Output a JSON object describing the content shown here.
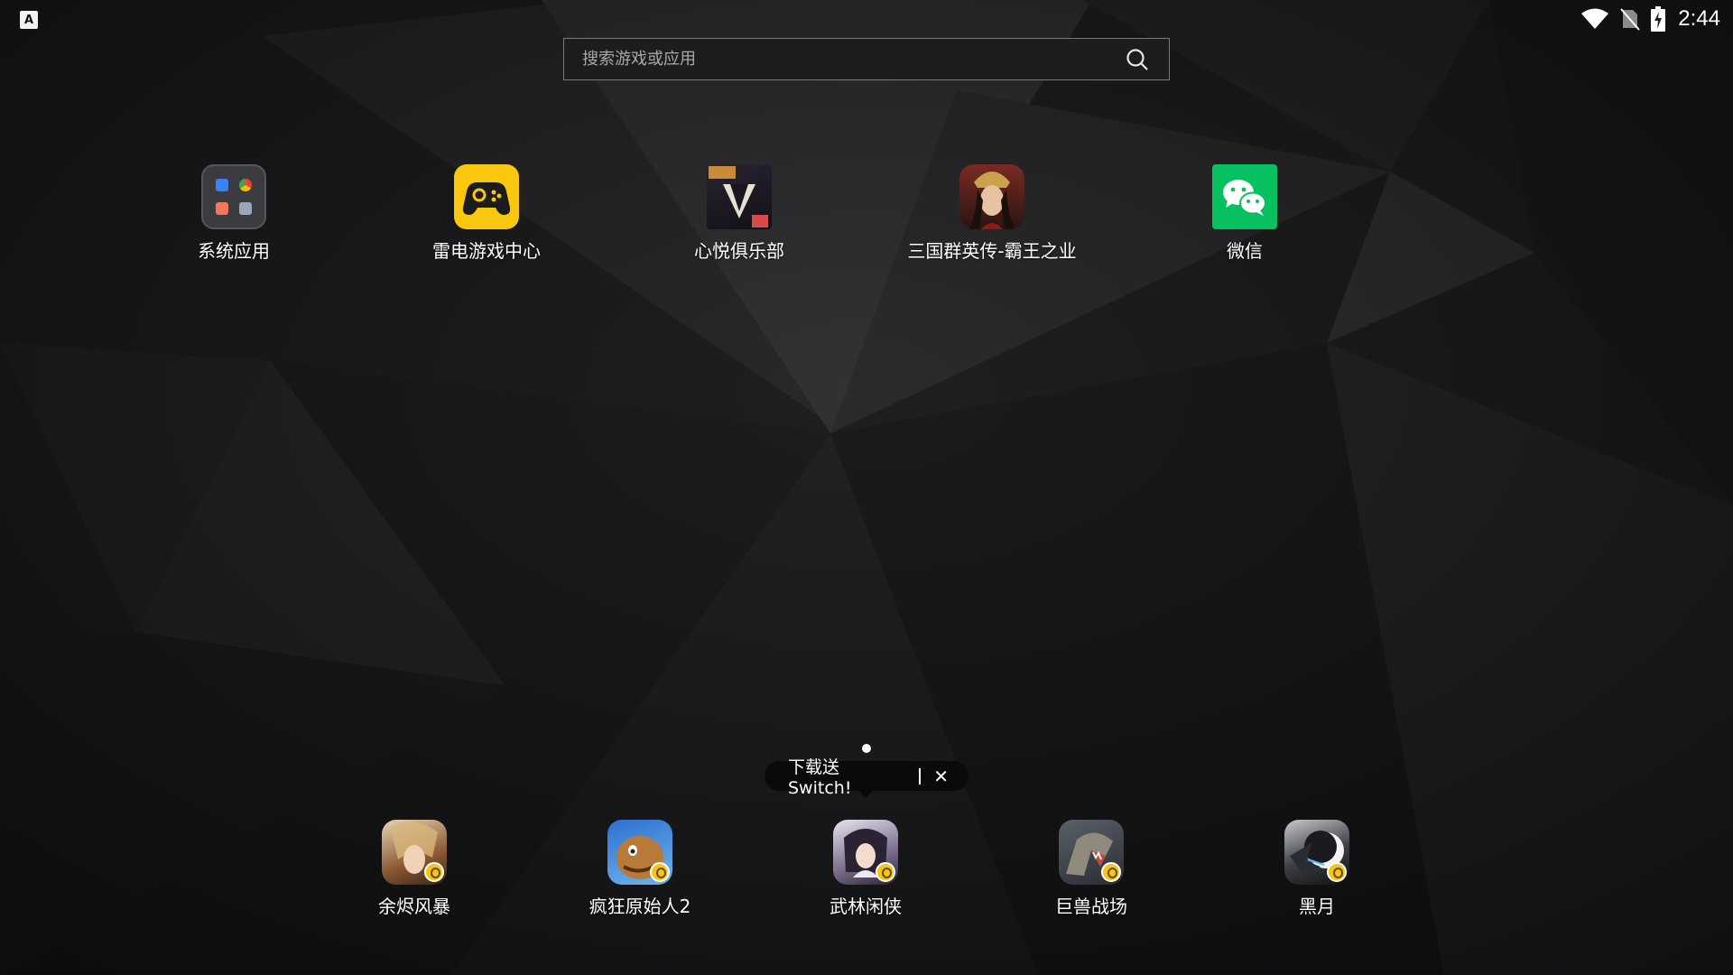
{
  "status_bar": {
    "time": "2:44",
    "notification_icon": "A",
    "icons": [
      "wifi-icon",
      "no-sim-icon",
      "battery-charging-icon"
    ]
  },
  "search": {
    "placeholder": "搜索游戏或应用"
  },
  "desktop_apps": [
    {
      "label": "系统应用",
      "icon": "folder-icon"
    },
    {
      "label": "雷电游戏中心",
      "icon": "gamepad-icon"
    },
    {
      "label": "心悦俱乐部",
      "icon": "xinyue-club-icon"
    },
    {
      "label": "三国群英传-霸王之业",
      "icon": "sanguo-game-icon"
    },
    {
      "label": "微信",
      "icon": "wechat-icon"
    }
  ],
  "promo_tooltip": {
    "text": "下载送Switch!"
  },
  "dock_apps": [
    {
      "label": "余烬风暴",
      "icon": "game-icon"
    },
    {
      "label": "疯狂原始人2",
      "icon": "game-icon"
    },
    {
      "label": "武林闲侠",
      "icon": "game-icon"
    },
    {
      "label": "巨兽战场",
      "icon": "game-icon"
    },
    {
      "label": "黑月",
      "icon": "game-icon"
    }
  ],
  "colors": {
    "wechat_green": "#07c160",
    "gamecenter_yellow": "#f9c80e",
    "badge_yellow": "#f5c518"
  }
}
